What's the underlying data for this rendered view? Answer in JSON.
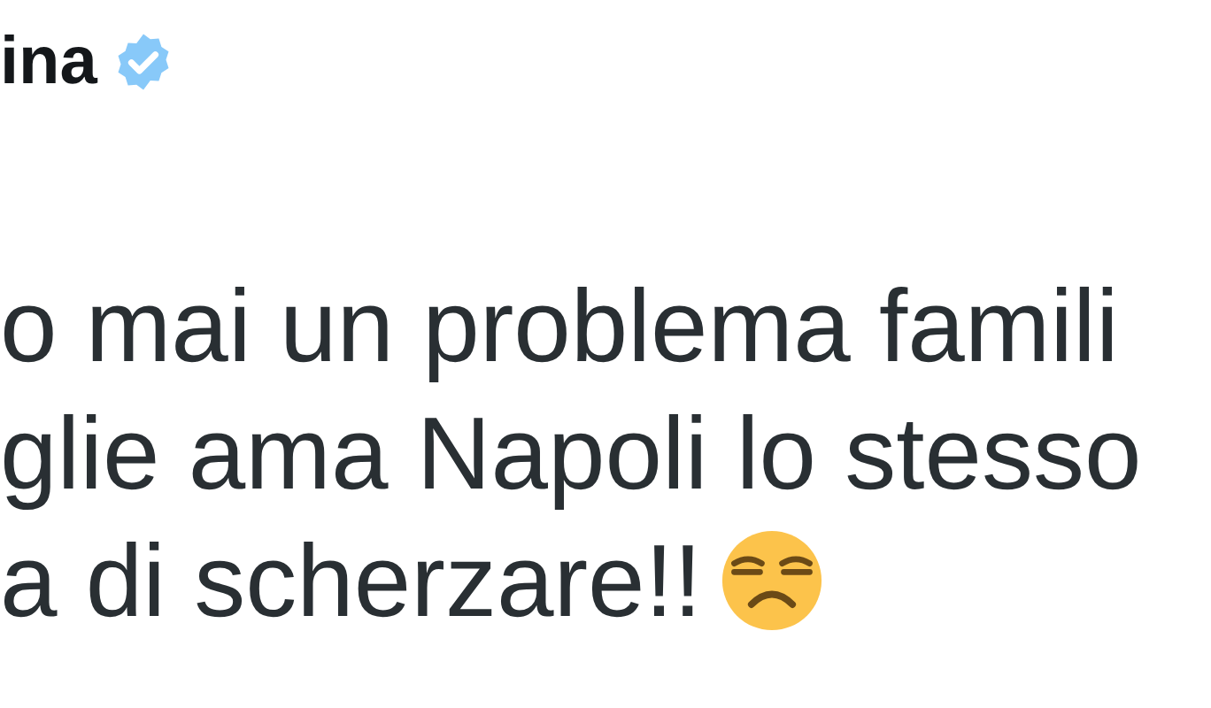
{
  "author": {
    "name": "ina",
    "verified": true
  },
  "tweet": {
    "lines": [
      "o mai un problema famili",
      "glie ama Napoli lo stesso",
      "a di scherzare!!"
    ]
  }
}
